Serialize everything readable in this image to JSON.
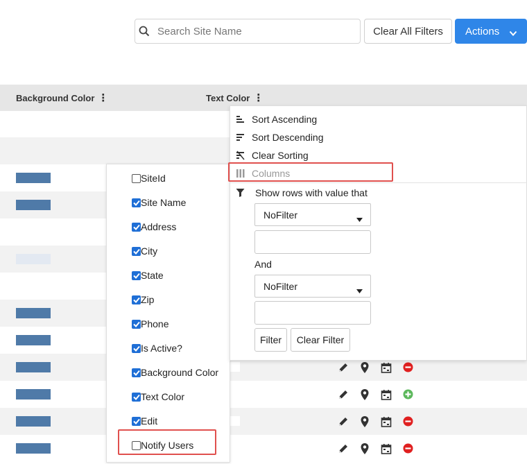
{
  "toolbar": {
    "search_placeholder": "Search Site Name",
    "search_value": "",
    "clear_filters_label": "Clear All Filters",
    "actions_label": "Actions",
    "accent_color": "#2f86e8"
  },
  "grid": {
    "columns": [
      {
        "label": "Background Color"
      },
      {
        "label": "Text Color"
      }
    ],
    "rows": [
      {
        "swatch": null,
        "alt": false
      },
      {
        "swatch": null,
        "alt": true
      },
      {
        "swatch": "#4f7aa8",
        "alt": false
      },
      {
        "swatch": "#4f7aa8",
        "alt": true
      },
      {
        "swatch": null,
        "alt": false
      },
      {
        "swatch": "#e3e9f2",
        "alt": true
      },
      {
        "swatch": null,
        "alt": false
      },
      {
        "swatch": "#4f7aa8",
        "alt": true
      },
      {
        "swatch": "#4f7aa8",
        "alt": false
      },
      {
        "swatch": "#4f7aa8",
        "alt": true,
        "status": "remove"
      },
      {
        "swatch": "#4f7aa8",
        "alt": false,
        "status": "add"
      },
      {
        "swatch": "#4f7aa8",
        "alt": true,
        "status": "remove"
      },
      {
        "swatch": "#4f7aa8",
        "alt": false,
        "status": "remove"
      }
    ],
    "row_icons": [
      "pencil-icon",
      "map-pin-icon",
      "calendar-icon",
      "status-icon"
    ],
    "remove_color": "#e02020",
    "add_color": "#5cb85c"
  },
  "columns_panel": {
    "options": [
      {
        "label": "SiteId",
        "checked": false
      },
      {
        "label": "Site Name",
        "checked": true
      },
      {
        "label": "Address",
        "checked": true
      },
      {
        "label": "City",
        "checked": true
      },
      {
        "label": "State",
        "checked": true
      },
      {
        "label": "Zip",
        "checked": true
      },
      {
        "label": "Phone",
        "checked": true
      },
      {
        "label": "Is Active?",
        "checked": true
      },
      {
        "label": "Background Color",
        "checked": true
      },
      {
        "label": "Text Color",
        "checked": true
      },
      {
        "label": "Edit",
        "checked": true
      },
      {
        "label": "Notify Users",
        "checked": false
      }
    ]
  },
  "column_menu": {
    "sort_ascending": "Sort Ascending",
    "sort_descending": "Sort Descending",
    "clear_sorting": "Clear Sorting",
    "columns": "Columns",
    "filter_heading": "Show rows with value that",
    "operator_1": "NoFilter",
    "value_1": "",
    "and_label": "And",
    "operator_2": "NoFilter",
    "value_2": "",
    "filter_button": "Filter",
    "clear_filter_button": "Clear Filter"
  }
}
